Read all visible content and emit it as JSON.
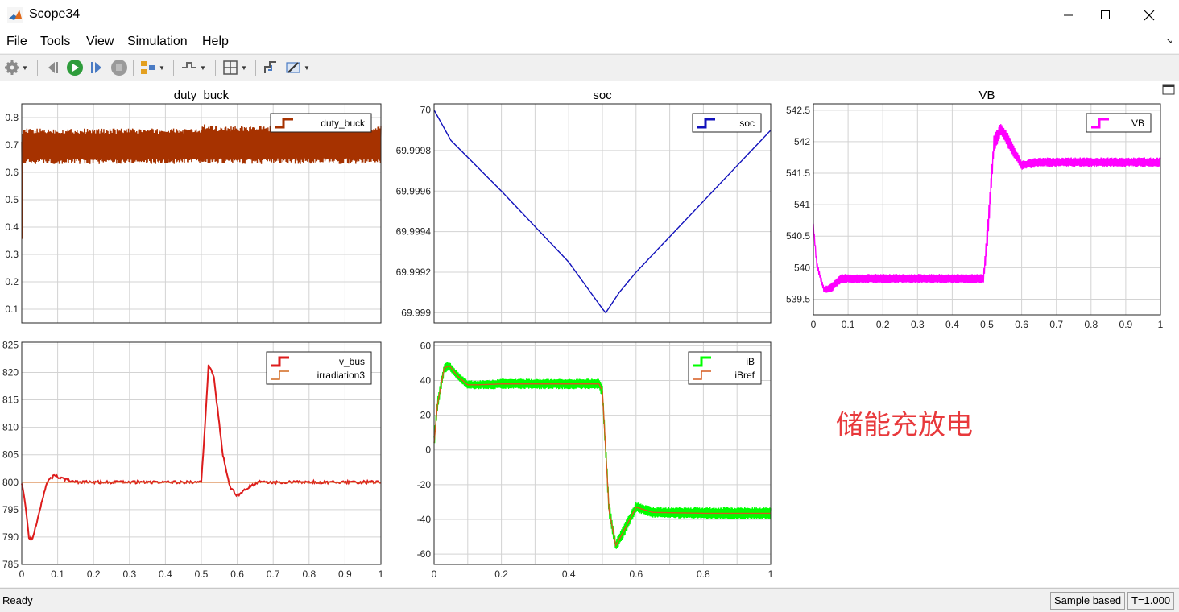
{
  "window": {
    "title": "Scope34"
  },
  "menu": {
    "file": "File",
    "tools": "Tools",
    "view": "View",
    "simulation": "Simulation",
    "help": "Help"
  },
  "toolbar": {
    "icons": [
      "gear-icon",
      "step-back-icon",
      "run-icon",
      "step-forward-icon",
      "stop-icon",
      "highlight-icon",
      "trigger-icon",
      "zoom-icon",
      "autoscale-icon",
      "measure-icon"
    ]
  },
  "status": {
    "left": "Ready",
    "mode": "Sample based",
    "time": "T=1.000"
  },
  "annotation": "储能充放电",
  "colors": {
    "duty": "#a63200",
    "soc": "#1111bb",
    "vb": "#ff00ff",
    "vbus": "#dd1c1c",
    "irr": "#d2691e",
    "ib": "#00ff00",
    "ibref": "#d55a1e"
  },
  "chart_data": [
    {
      "type": "line",
      "title": "duty_buck",
      "xlim": [
        0,
        1
      ],
      "ylim": [
        0.05,
        0.85
      ],
      "xticks": [],
      "yticks": [
        "0.1",
        "0.2",
        "0.3",
        "0.4",
        "0.5",
        "0.6",
        "0.7",
        "0.8"
      ],
      "grid": true,
      "legend": "top-right",
      "series": [
        {
          "name": "duty_buck",
          "color": "#a63200",
          "band": true,
          "x": [
            0,
            0.004,
            0.01,
            0.2,
            0.49,
            0.5,
            0.505,
            0.52,
            0.7,
            1.0
          ],
          "lo": [
            0.1,
            0.62,
            0.63,
            0.63,
            0.63,
            0.63,
            0.63,
            0.63,
            0.63,
            0.63
          ],
          "hi": [
            0.82,
            0.77,
            0.76,
            0.76,
            0.76,
            0.76,
            0.78,
            0.77,
            0.77,
            0.77
          ]
        }
      ]
    },
    {
      "type": "line",
      "title": "soc",
      "xlim": [
        0,
        1
      ],
      "ylim": [
        69.99895,
        70.00003
      ],
      "xticks": [],
      "yticks": [
        "70",
        "69.9998",
        "69.9996",
        "69.9994",
        "69.9992",
        "69.999"
      ],
      "ytickvals": [
        70,
        69.9998,
        69.9996,
        69.9994,
        69.9992,
        69.999
      ],
      "grid": true,
      "legend": "top-right",
      "series": [
        {
          "name": "soc",
          "color": "#1111bb",
          "x": [
            0,
            0.05,
            0.2,
            0.4,
            0.5,
            0.51,
            0.55,
            0.6,
            0.8,
            1.0
          ],
          "y": [
            70.0,
            69.99985,
            69.9996,
            69.99925,
            69.99902,
            69.999,
            69.9991,
            69.9992,
            69.99955,
            69.9999
          ]
        }
      ]
    },
    {
      "type": "line",
      "title": "VB",
      "xlim": [
        0,
        1
      ],
      "ylim": [
        539.25,
        542.6
      ],
      "xticks": [
        "0",
        "0.1",
        "0.2",
        "0.3",
        "0.4",
        "0.5",
        "0.6",
        "0.7",
        "0.8",
        "0.9",
        "1"
      ],
      "yticks": [
        "542.5",
        "542",
        "541.5",
        "541",
        "540.5",
        "540",
        "539.5"
      ],
      "ytickvals": [
        542.5,
        542,
        541.5,
        541,
        540.5,
        540,
        539.5
      ],
      "grid": true,
      "legend": "top-right",
      "series": [
        {
          "name": "VB",
          "color": "#ff00ff",
          "band": true,
          "x": [
            0,
            0.01,
            0.03,
            0.05,
            0.08,
            0.12,
            0.3,
            0.49,
            0.5,
            0.52,
            0.54,
            0.56,
            0.6,
            0.65,
            0.8,
            1.0
          ],
          "lo": [
            540.6,
            540.0,
            539.6,
            539.6,
            539.75,
            539.75,
            539.75,
            539.75,
            540.2,
            541.8,
            542.1,
            541.9,
            541.55,
            541.6,
            541.6,
            541.6
          ],
          "hi": [
            540.7,
            540.1,
            539.7,
            539.75,
            539.9,
            539.9,
            539.9,
            539.9,
            540.6,
            542.1,
            542.3,
            542.15,
            541.7,
            541.75,
            541.75,
            541.75
          ]
        }
      ]
    },
    {
      "type": "line",
      "title": "",
      "xlim": [
        0,
        1
      ],
      "ylim": [
        785,
        825.5
      ],
      "xticks": [
        "0",
        "0.1",
        "0.2",
        "0.3",
        "0.4",
        "0.5",
        "0.6",
        "0.7",
        "0.8",
        "0.9",
        "1"
      ],
      "yticks": [
        "825",
        "820",
        "815",
        "810",
        "805",
        "800",
        "795",
        "790",
        "785"
      ],
      "ytickvals": [
        825,
        820,
        815,
        810,
        805,
        800,
        795,
        790,
        785
      ],
      "grid": true,
      "legend": "top-right",
      "series": [
        {
          "name": "v_bus",
          "color": "#dd1c1c",
          "x": [
            0,
            0.01,
            0.02,
            0.03,
            0.05,
            0.07,
            0.09,
            0.12,
            0.15,
            0.5,
            0.51,
            0.52,
            0.535,
            0.56,
            0.58,
            0.6,
            0.63,
            0.66,
            0.7,
            1.0
          ],
          "y": [
            800,
            796,
            790,
            789.5,
            795,
            800,
            801.2,
            800.5,
            800,
            800,
            810,
            821.5,
            819,
            805,
            799,
            797.6,
            799,
            800.2,
            800,
            800
          ]
        },
        {
          "name": "irradiation3",
          "color": "#d2691e",
          "x": [
            0,
            1
          ],
          "y": [
            800,
            800
          ]
        }
      ]
    },
    {
      "type": "line",
      "title": "",
      "xlim": [
        0,
        1
      ],
      "ylim": [
        -66,
        62
      ],
      "xticks": [
        "0",
        "0.2",
        "0.4",
        "0.6",
        "0.8",
        "1"
      ],
      "yticks": [
        "60",
        "40",
        "20",
        "0",
        "-20",
        "-40",
        "-60"
      ],
      "ytickvals": [
        60,
        40,
        20,
        0,
        -20,
        -40,
        -60
      ],
      "grid": true,
      "legend": "top-right",
      "series": [
        {
          "name": "iB",
          "color": "#00ff00",
          "band": true,
          "x": [
            0,
            0.01,
            0.03,
            0.045,
            0.07,
            0.1,
            0.13,
            0.2,
            0.49,
            0.5,
            0.52,
            0.54,
            0.56,
            0.6,
            0.65,
            0.8,
            1.0
          ],
          "lo": [
            0,
            22,
            44,
            46,
            40,
            35,
            35,
            35,
            35,
            30,
            -40,
            -58,
            -52,
            -36,
            -39,
            -40,
            -40
          ],
          "hi": [
            8,
            30,
            50,
            51,
            45,
            40,
            40,
            41,
            41,
            38,
            -30,
            -52,
            -44,
            -30,
            -33,
            -33,
            -33
          ]
        },
        {
          "name": "iBref",
          "color": "#d55a1e",
          "x": [
            0,
            0.01,
            0.03,
            0.045,
            0.07,
            0.1,
            0.13,
            0.2,
            0.49,
            0.5,
            0.52,
            0.54,
            0.56,
            0.6,
            0.65,
            0.8,
            1.0
          ],
          "y": [
            4,
            26,
            47,
            48.5,
            42.5,
            37.5,
            37.5,
            38,
            38,
            34,
            -35,
            -55,
            -48,
            -33,
            -36,
            -36.5,
            -36.5
          ]
        }
      ]
    }
  ]
}
